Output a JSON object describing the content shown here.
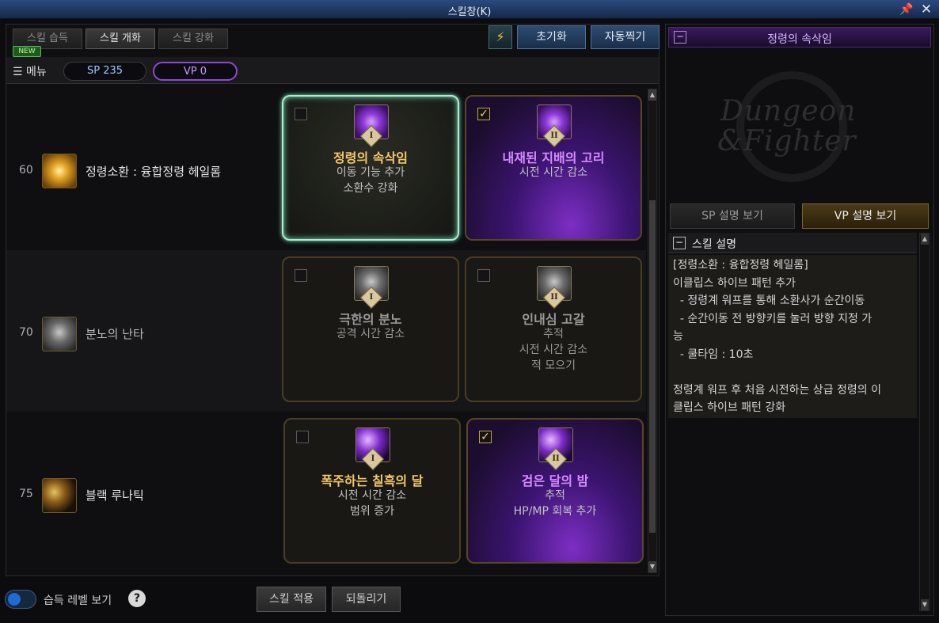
{
  "window": {
    "title": "스킬창(K)"
  },
  "tabs": [
    {
      "label": "스킬 습득",
      "active": false
    },
    {
      "label": "스킬 개화",
      "active": true
    },
    {
      "label": "스킬 강화",
      "active": false
    }
  ],
  "badge_new": "NEW",
  "toolbar": {
    "reset_label": "초기화",
    "auto_label": "자동찍기",
    "quick_icon": "lightning-icon"
  },
  "menubar": {
    "menu_label": "메뉴",
    "sp_label": "SP 235",
    "vp_label": "VP 0"
  },
  "skills": [
    {
      "level": "60",
      "name": "정령소환 : 융합정령 헤일롬",
      "icon": "fusion-spirit-icon",
      "options": [
        {
          "roman": "I",
          "title": "정령의 속삭임",
          "desc": [
            "이동 기능 추가",
            "소환수 강화"
          ],
          "checked": false,
          "selected": true,
          "title_color": "#f2c76a"
        },
        {
          "roman": "II",
          "title": "내재된 지배의 고리",
          "desc": [
            "시전 시간 감소"
          ],
          "checked": true,
          "selected": false,
          "title_color": "#d58cff"
        }
      ]
    },
    {
      "level": "70",
      "name": "분노의 난타",
      "icon": "rage-beast-icon",
      "options": [
        {
          "roman": "I",
          "title": "극한의 분노",
          "desc": [
            "공격 시간 감소"
          ],
          "checked": false,
          "selected": false,
          "title_color": "#9a9a9a"
        },
        {
          "roman": "II",
          "title": "인내심 고갈",
          "desc": [
            "추적",
            "시전 시간 감소",
            "적 모으기"
          ],
          "checked": false,
          "selected": false,
          "title_color": "#9a9a9a"
        }
      ]
    },
    {
      "level": "75",
      "name": "블랙 루나틱",
      "icon": "black-moon-icon",
      "options": [
        {
          "roman": "I",
          "title": "폭주하는 칠흑의 달",
          "desc": [
            "시전 시간 감소",
            "범위 증가"
          ],
          "checked": false,
          "selected": false,
          "title_color": "#f2c76a"
        },
        {
          "roman": "II",
          "title": "검은 달의 밤",
          "desc": [
            "추적",
            "HP/MP 회복 추가"
          ],
          "checked": true,
          "selected": false,
          "title_color": "#d58cff"
        }
      ]
    }
  ],
  "bottom": {
    "toggle_label": "습득 레벨 보기",
    "help": "?",
    "apply_label": "스킬 적용",
    "revert_label": "되돌리기"
  },
  "right": {
    "header_title": "정령의 속삭임",
    "logo_line1": "Dungeon",
    "logo_line2": "&Fighter",
    "sp_tab": "SP 설명 보기",
    "vp_tab": "VP 설명 보기",
    "desc_title": "스킬 설명",
    "desc_lines": [
      "[정령소환 : 융합정령 헤일롬]",
      "이클립스 하이브 패턴 추가",
      "  - 정령계 워프를 통해 소환사가 순간이동",
      "  - 순간이동 전 방향키를 눌러 방향 지정 가",
      "능",
      "  - 쿨타임 : 10초",
      "",
      "정령계 워프 후 처음 시전하는 상급 정령의 이",
      "클립스 하이브 패턴 강화"
    ]
  }
}
